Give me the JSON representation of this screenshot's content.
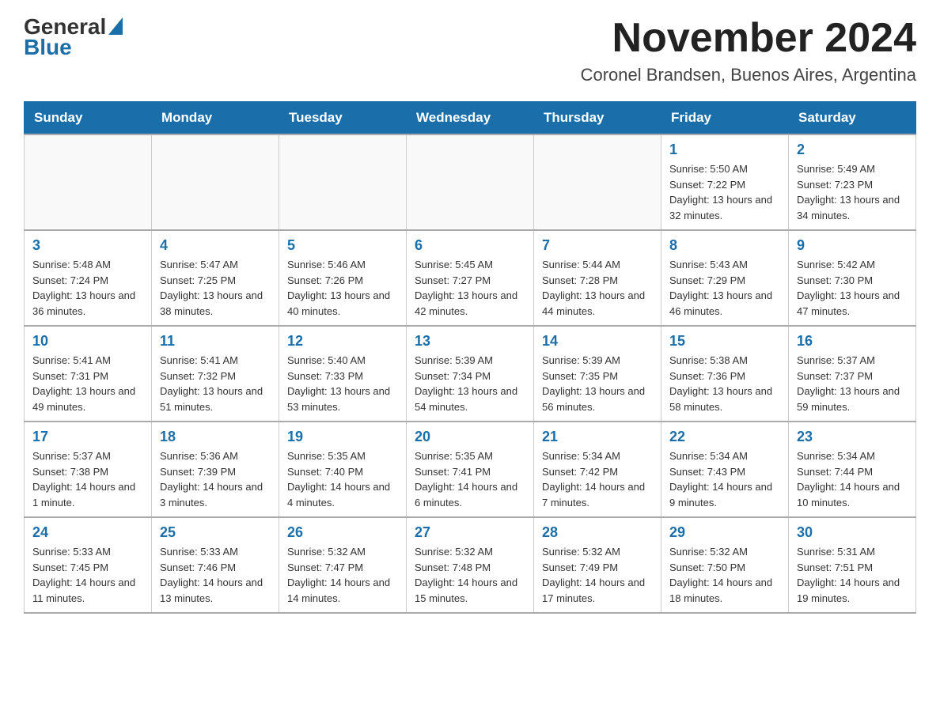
{
  "header": {
    "logo_general": "General",
    "logo_blue": "Blue",
    "month_title": "November 2024",
    "location": "Coronel Brandsen, Buenos Aires, Argentina"
  },
  "days_of_week": [
    "Sunday",
    "Monday",
    "Tuesday",
    "Wednesday",
    "Thursday",
    "Friday",
    "Saturday"
  ],
  "weeks": [
    [
      {
        "day": "",
        "info": ""
      },
      {
        "day": "",
        "info": ""
      },
      {
        "day": "",
        "info": ""
      },
      {
        "day": "",
        "info": ""
      },
      {
        "day": "",
        "info": ""
      },
      {
        "day": "1",
        "info": "Sunrise: 5:50 AM\nSunset: 7:22 PM\nDaylight: 13 hours and 32 minutes."
      },
      {
        "day": "2",
        "info": "Sunrise: 5:49 AM\nSunset: 7:23 PM\nDaylight: 13 hours and 34 minutes."
      }
    ],
    [
      {
        "day": "3",
        "info": "Sunrise: 5:48 AM\nSunset: 7:24 PM\nDaylight: 13 hours and 36 minutes."
      },
      {
        "day": "4",
        "info": "Sunrise: 5:47 AM\nSunset: 7:25 PM\nDaylight: 13 hours and 38 minutes."
      },
      {
        "day": "5",
        "info": "Sunrise: 5:46 AM\nSunset: 7:26 PM\nDaylight: 13 hours and 40 minutes."
      },
      {
        "day": "6",
        "info": "Sunrise: 5:45 AM\nSunset: 7:27 PM\nDaylight: 13 hours and 42 minutes."
      },
      {
        "day": "7",
        "info": "Sunrise: 5:44 AM\nSunset: 7:28 PM\nDaylight: 13 hours and 44 minutes."
      },
      {
        "day": "8",
        "info": "Sunrise: 5:43 AM\nSunset: 7:29 PM\nDaylight: 13 hours and 46 minutes."
      },
      {
        "day": "9",
        "info": "Sunrise: 5:42 AM\nSunset: 7:30 PM\nDaylight: 13 hours and 47 minutes."
      }
    ],
    [
      {
        "day": "10",
        "info": "Sunrise: 5:41 AM\nSunset: 7:31 PM\nDaylight: 13 hours and 49 minutes."
      },
      {
        "day": "11",
        "info": "Sunrise: 5:41 AM\nSunset: 7:32 PM\nDaylight: 13 hours and 51 minutes."
      },
      {
        "day": "12",
        "info": "Sunrise: 5:40 AM\nSunset: 7:33 PM\nDaylight: 13 hours and 53 minutes."
      },
      {
        "day": "13",
        "info": "Sunrise: 5:39 AM\nSunset: 7:34 PM\nDaylight: 13 hours and 54 minutes."
      },
      {
        "day": "14",
        "info": "Sunrise: 5:39 AM\nSunset: 7:35 PM\nDaylight: 13 hours and 56 minutes."
      },
      {
        "day": "15",
        "info": "Sunrise: 5:38 AM\nSunset: 7:36 PM\nDaylight: 13 hours and 58 minutes."
      },
      {
        "day": "16",
        "info": "Sunrise: 5:37 AM\nSunset: 7:37 PM\nDaylight: 13 hours and 59 minutes."
      }
    ],
    [
      {
        "day": "17",
        "info": "Sunrise: 5:37 AM\nSunset: 7:38 PM\nDaylight: 14 hours and 1 minute."
      },
      {
        "day": "18",
        "info": "Sunrise: 5:36 AM\nSunset: 7:39 PM\nDaylight: 14 hours and 3 minutes."
      },
      {
        "day": "19",
        "info": "Sunrise: 5:35 AM\nSunset: 7:40 PM\nDaylight: 14 hours and 4 minutes."
      },
      {
        "day": "20",
        "info": "Sunrise: 5:35 AM\nSunset: 7:41 PM\nDaylight: 14 hours and 6 minutes."
      },
      {
        "day": "21",
        "info": "Sunrise: 5:34 AM\nSunset: 7:42 PM\nDaylight: 14 hours and 7 minutes."
      },
      {
        "day": "22",
        "info": "Sunrise: 5:34 AM\nSunset: 7:43 PM\nDaylight: 14 hours and 9 minutes."
      },
      {
        "day": "23",
        "info": "Sunrise: 5:34 AM\nSunset: 7:44 PM\nDaylight: 14 hours and 10 minutes."
      }
    ],
    [
      {
        "day": "24",
        "info": "Sunrise: 5:33 AM\nSunset: 7:45 PM\nDaylight: 14 hours and 11 minutes."
      },
      {
        "day": "25",
        "info": "Sunrise: 5:33 AM\nSunset: 7:46 PM\nDaylight: 14 hours and 13 minutes."
      },
      {
        "day": "26",
        "info": "Sunrise: 5:32 AM\nSunset: 7:47 PM\nDaylight: 14 hours and 14 minutes."
      },
      {
        "day": "27",
        "info": "Sunrise: 5:32 AM\nSunset: 7:48 PM\nDaylight: 14 hours and 15 minutes."
      },
      {
        "day": "28",
        "info": "Sunrise: 5:32 AM\nSunset: 7:49 PM\nDaylight: 14 hours and 17 minutes."
      },
      {
        "day": "29",
        "info": "Sunrise: 5:32 AM\nSunset: 7:50 PM\nDaylight: 14 hours and 18 minutes."
      },
      {
        "day": "30",
        "info": "Sunrise: 5:31 AM\nSunset: 7:51 PM\nDaylight: 14 hours and 19 minutes."
      }
    ]
  ]
}
